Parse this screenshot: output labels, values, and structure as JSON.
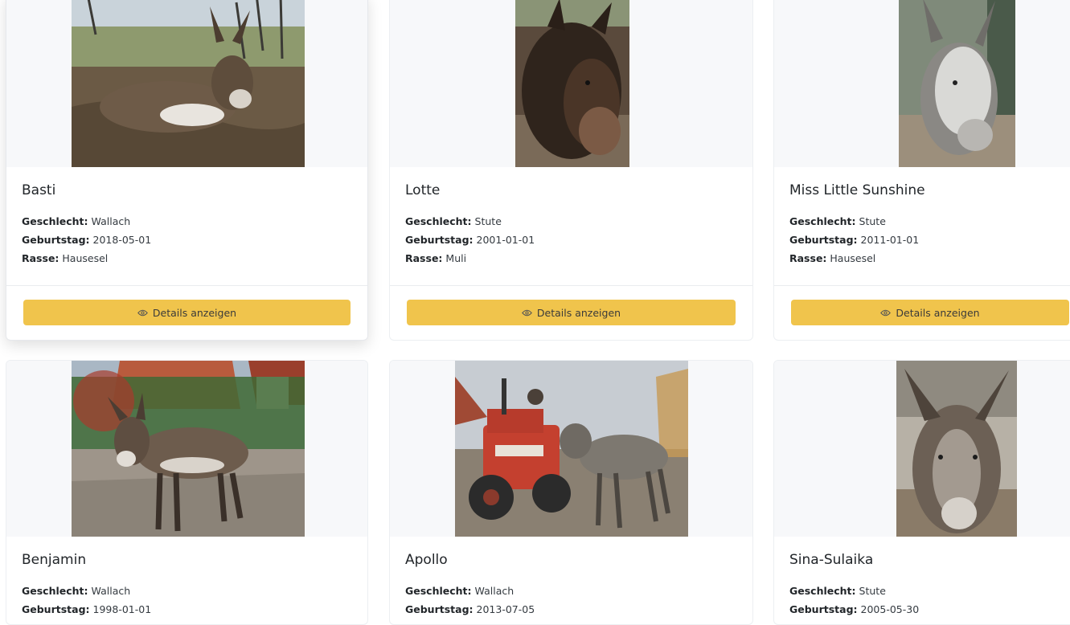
{
  "labels": {
    "sex": "Geschlecht:",
    "birthday": "Geburtstag:",
    "breed": "Rasse:",
    "details_button": "Details anzeigen"
  },
  "button_icon": "eye-icon",
  "colors": {
    "button": "#f0c44c",
    "photo_background": "#f7f8fa",
    "text": "#212529"
  },
  "animals": [
    {
      "name": "Basti",
      "sex": "Wallach",
      "birthday": "2018-05-01",
      "breed": "Hausesel"
    },
    {
      "name": "Lotte",
      "sex": "Stute",
      "birthday": "2001-01-01",
      "breed": "Muli"
    },
    {
      "name": "Miss Little Sunshine",
      "sex": "Stute",
      "birthday": "2011-01-01",
      "breed": "Hausesel"
    },
    {
      "name": "Benjamin",
      "sex": "Wallach",
      "birthday": "1998-01-01",
      "breed": ""
    },
    {
      "name": "Apollo",
      "sex": "Wallach",
      "birthday": "2013-07-05",
      "breed": ""
    },
    {
      "name": "Sina-Sulaika",
      "sex": "Stute",
      "birthday": "2005-05-30",
      "breed": ""
    }
  ]
}
